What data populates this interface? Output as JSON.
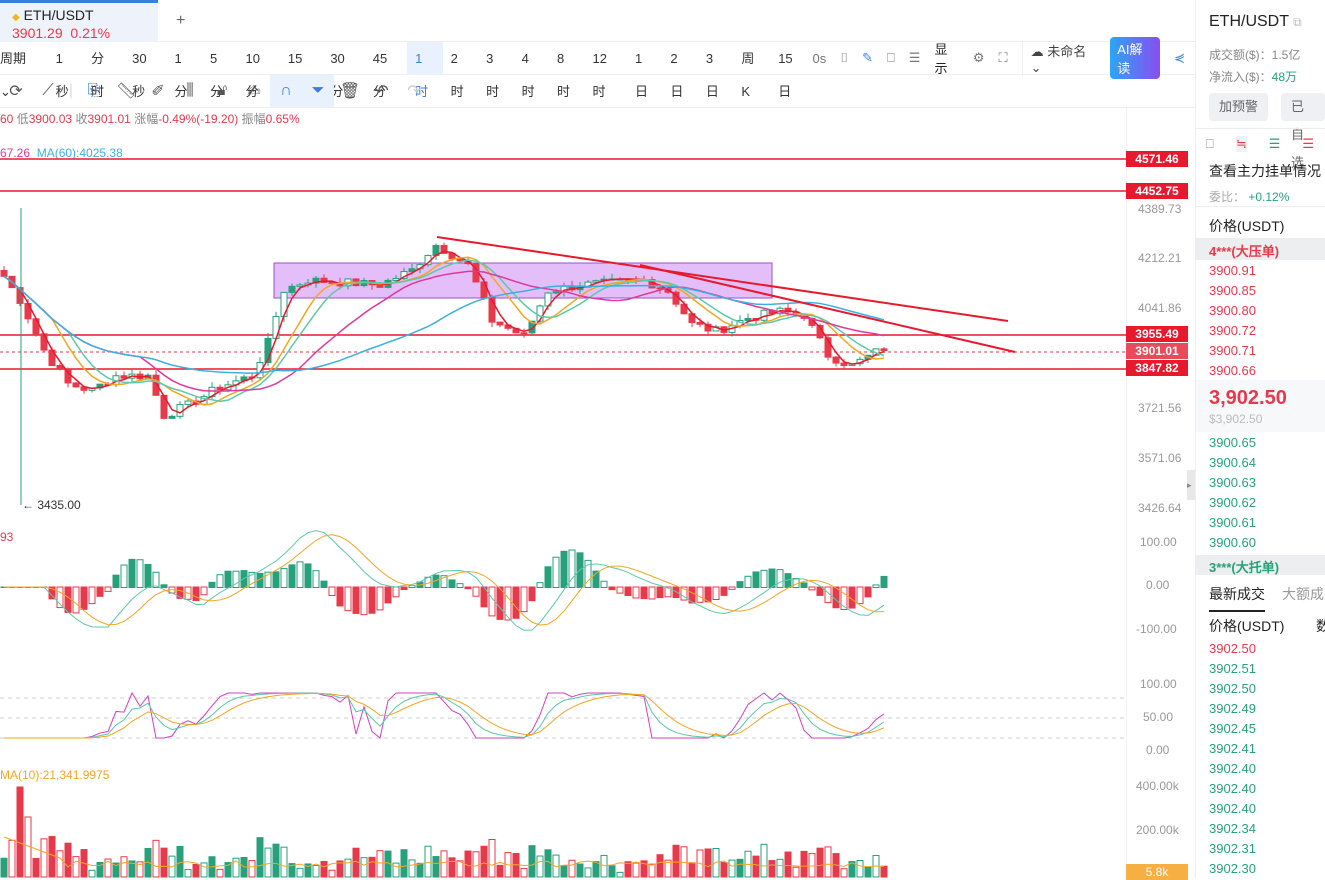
{
  "tab": {
    "symbol": "ETH/USDT",
    "price": "3901.29",
    "change": "0.21%",
    "add": "+"
  },
  "timeframes": {
    "period": "周期",
    "items": [
      "1秒",
      "分时",
      "30秒",
      "1分",
      "5分",
      "10分",
      "15分",
      "30分",
      "45分",
      "1时",
      "2时",
      "3时",
      "4时",
      "8时",
      "12时",
      "1日",
      "2日",
      "3日",
      "周K",
      "15日"
    ],
    "active": "1时"
  },
  "toolbar_right": {
    "countdown": "0s",
    "display": "显示",
    "layout": "未命名",
    "ai": "AI解读"
  },
  "info": {
    "prefix": "60",
    "low_label": "低",
    "low": "3900.03",
    "close_label": "收",
    "close": "3901.01",
    "chg_label": "涨幅",
    "chg": "-0.49%(-19.20)",
    "amp_label": "振幅",
    "amp": "0.65%"
  },
  "ma": {
    "ma30": "67.26",
    "ma60": "MA(60):4025.38"
  },
  "price_axis": [
    "4389.73",
    "4212.21",
    "4041.86",
    "3721.56",
    "3571.06",
    "3426.64"
  ],
  "price_levels": {
    "l1": "4571.46",
    "l2": "4452.75",
    "l3": "3955.49",
    "current": "3901.01",
    "l4": "3847.82"
  },
  "low_marker": "← 3435.00",
  "macd": {
    "label": "93",
    "axis": [
      "100.00",
      "0.00",
      "-100.00"
    ]
  },
  "kdj": {
    "axis": [
      "100.00",
      "50.00",
      "0.00"
    ]
  },
  "volume": {
    "label": "MA(10):21,341.9975",
    "axis": [
      "400.00k",
      "200.00k"
    ],
    "current": "5.8k"
  },
  "colors": {
    "up": "#26a17b",
    "down": "#e8394a",
    "ma_fast": "#f5a623",
    "ma_mid": "#e0399a",
    "ma_slow": "#3bb0e0"
  },
  "price_path": [
    [
      0,
      4150
    ],
    [
      2,
      4069
    ],
    [
      5,
      3907
    ],
    [
      8,
      3800
    ],
    [
      11,
      3778
    ],
    [
      14,
      3826
    ],
    [
      18,
      3826
    ],
    [
      20,
      3700
    ],
    [
      23,
      3730
    ],
    [
      27,
      3790
    ],
    [
      31,
      3826
    ],
    [
      33,
      3930
    ],
    [
      35,
      4103
    ],
    [
      38,
      4137
    ],
    [
      42,
      4130
    ],
    [
      47,
      4120
    ],
    [
      51,
      4171
    ],
    [
      54,
      4259
    ],
    [
      58,
      4188
    ],
    [
      61,
      4002
    ],
    [
      65,
      3952
    ],
    [
      68,
      4100
    ],
    [
      72,
      4120
    ],
    [
      77,
      4130
    ],
    [
      80,
      4137
    ],
    [
      83,
      4100
    ],
    [
      86,
      3990
    ],
    [
      89,
      3968
    ],
    [
      93,
      4010
    ],
    [
      97,
      4030
    ],
    [
      100,
      4020
    ],
    [
      103,
      3892
    ],
    [
      106,
      3858
    ],
    [
      110,
      3914
    ]
  ],
  "right": {
    "symbol": "ETH/USDT",
    "turnover_label": "成交额($)：",
    "turnover": "1.5亿",
    "inflow_label": "净流入($)：",
    "inflow": "48万",
    "alert": "加预警",
    "fav": "已自选",
    "depth_title": "查看主力挂单情况",
    "ratio_label": "委比：",
    "ratio": "+0.12%",
    "price_header": "价格(USDT)",
    "ask_big": "4***(大压单)",
    "asks": [
      "3900.91",
      "3900.85",
      "3900.80",
      "3900.72",
      "3900.71",
      "3900.66"
    ],
    "last": "3,902.50",
    "last_usd": "$3,902.50",
    "bids": [
      "3900.65",
      "3900.64",
      "3900.63",
      "3900.62",
      "3900.61",
      "3900.60"
    ],
    "bid_big": "3***(大托单)",
    "trade_tab1": "最新成交",
    "trade_tab2": "大额成交",
    "trade_price_header": "价格(USDT)",
    "trade_qty_header": "数",
    "trades": [
      [
        "3902.50",
        "down"
      ],
      [
        "3902.51",
        "up"
      ],
      [
        "3902.50",
        "up"
      ],
      [
        "3902.49",
        "up"
      ],
      [
        "3902.45",
        "up"
      ],
      [
        "3902.41",
        "up"
      ],
      [
        "3902.40",
        "up"
      ],
      [
        "3902.40",
        "up"
      ],
      [
        "3902.40",
        "up"
      ],
      [
        "3902.34",
        "up"
      ],
      [
        "3902.31",
        "up"
      ],
      [
        "3902.30",
        "up"
      ]
    ]
  }
}
